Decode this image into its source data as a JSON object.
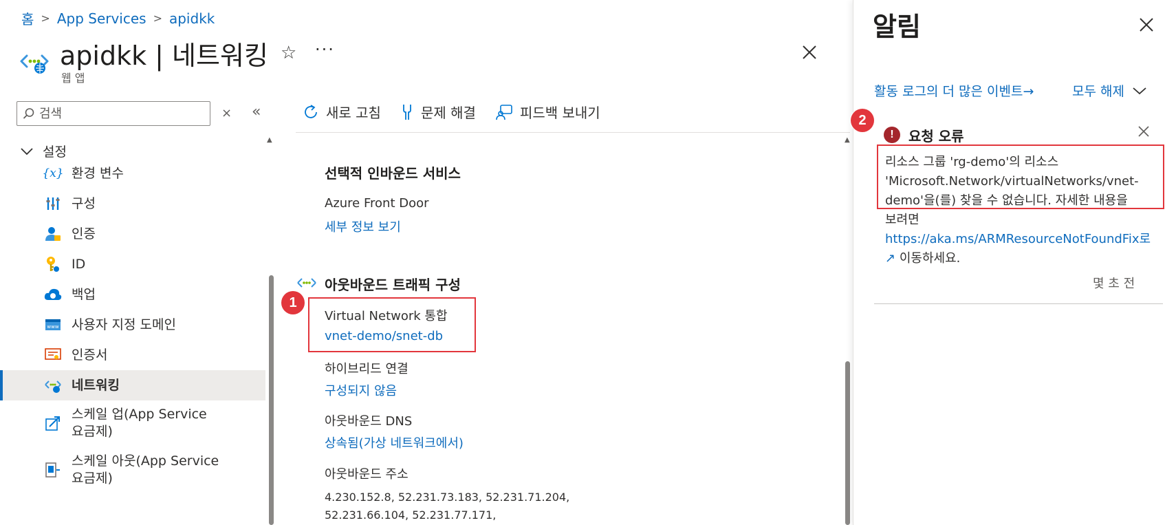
{
  "breadcrumb": {
    "items": [
      "홈",
      "App Services",
      "apidkk"
    ],
    "separator": ">"
  },
  "header": {
    "title": "apidkk | 네트워킹",
    "subtitle": "웹 앱",
    "favorite_icon": "star-outline-icon",
    "more_label": "···",
    "close_icon": "close-icon"
  },
  "sidebar": {
    "search_placeholder": "검색",
    "clear_label": "×",
    "collapse_label": "«",
    "group": {
      "label": "설정",
      "chevron": "⌵"
    },
    "items": [
      {
        "label": "환경 변수",
        "icon": "variable-icon",
        "selected": false
      },
      {
        "label": "구성",
        "icon": "sliders-icon",
        "selected": false
      },
      {
        "label": "인증",
        "icon": "user-lock-icon",
        "selected": false
      },
      {
        "label": "ID",
        "icon": "key-icon",
        "selected": false
      },
      {
        "label": "백업",
        "icon": "cloud-backup-icon",
        "selected": false
      },
      {
        "label": "사용자 지정 도메인",
        "icon": "www-icon",
        "selected": false
      },
      {
        "label": "인증서",
        "icon": "certificate-icon",
        "selected": false
      },
      {
        "label": "네트워킹",
        "icon": "networking-icon",
        "selected": true
      },
      {
        "label": "스케일 업(App Service",
        "label2": "요금제)",
        "icon": "scale-up-icon",
        "selected": false
      },
      {
        "label": "스케일 아웃(App Service",
        "label2": "요금제)",
        "icon": "scale-out-icon",
        "selected": false
      }
    ]
  },
  "toolbar": {
    "refresh_label": "새로 고침",
    "troubleshoot_label": "문제 해결",
    "feedback_label": "피드백 보내기"
  },
  "content": {
    "inbound": {
      "heading": "선택적 인바운드 서비스",
      "service_label": "Azure Front Door",
      "details_link": "세부 정보 보기"
    },
    "outbound": {
      "heading": "아웃바운드 트래픽 구성",
      "vnet_label": "Virtual Network 통합",
      "vnet_value": "vnet-demo/snet-db",
      "hybrid_label": "하이브리드 연결",
      "hybrid_value": "구성되지 않음",
      "dns_label": "아웃바운드 DNS",
      "dns_value": "상속됨(가상 네트워크에서)",
      "address_label": "아웃바운드 주소",
      "address_line1": "4.230.152.8, 52.231.73.183, 52.231.71.204,",
      "address_line2": "52.231.66.104, 52.231.77.171,"
    }
  },
  "callouts": {
    "one": "1",
    "two": "2",
    "color": "#e2363c"
  },
  "notifications": {
    "title": "알림",
    "activity_link": "활동 로그의 더 많은 이벤트→",
    "dismiss_all": "모두 해제",
    "card": {
      "title": "요청 오류",
      "message_line1": "리소스 그룹 'rg-demo'의 리소스",
      "message_line2": "'Microsoft.Network/virtualNetworks/vnet-",
      "message_line3": "demo'을(를) 찾을 수 없습니다. 자세한 내용을",
      "message_line4": "보려면",
      "link": "https://aka.ms/ARMResourceNotFoundFix로",
      "message_tail": "이동하세요.",
      "time": "몇 초 전"
    }
  },
  "colors": {
    "link": "#0f6cbd",
    "error": "#a4262c",
    "callout": "#e2363c"
  }
}
